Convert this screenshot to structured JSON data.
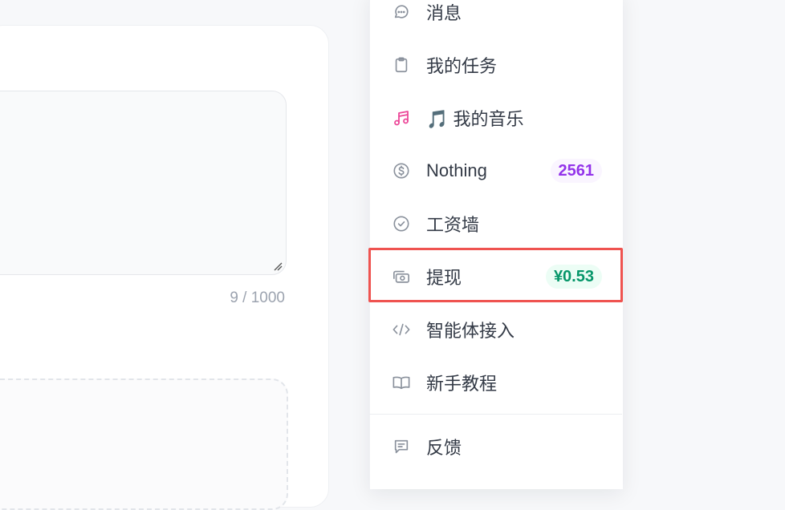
{
  "editor": {
    "char_counter": "9 / 1000"
  },
  "menu": {
    "items": [
      {
        "label": "消息",
        "icon": "message-circle-icon"
      },
      {
        "label": "我的任务",
        "icon": "clipboard-icon"
      },
      {
        "label": "🎵 我的音乐",
        "icon": "music-notes-icon"
      },
      {
        "label": "Nothing",
        "icon": "dollar-circle-icon",
        "badge": "2561"
      },
      {
        "label": "工资墙",
        "icon": "check-circle-icon"
      },
      {
        "label": "提现",
        "icon": "withdraw-camera-icon",
        "badge": "¥0.53"
      },
      {
        "label": "智能体接入",
        "icon": "code-icon"
      },
      {
        "label": "新手教程",
        "icon": "book-icon"
      },
      {
        "label": "反馈",
        "icon": "feedback-message-icon"
      }
    ]
  },
  "colors": {
    "highlight": "#ef5350",
    "badge_purple": "#9333ea",
    "badge_green": "#059669",
    "music_icon": "#ec4899"
  }
}
